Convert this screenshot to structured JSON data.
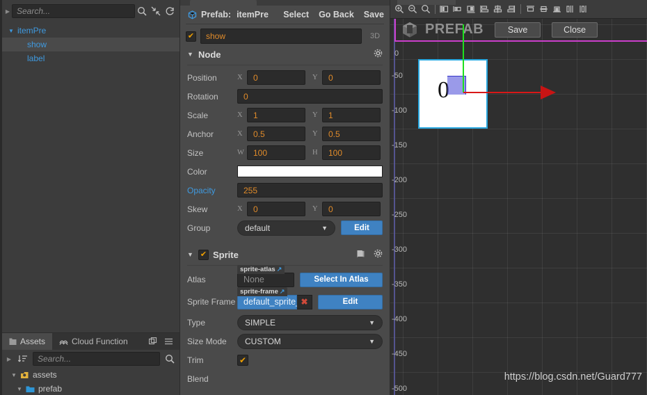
{
  "hierarchy": {
    "search_placeholder": "Search...",
    "icons": [
      "search-icon",
      "collapse-icon",
      "refresh-icon"
    ],
    "tree": [
      {
        "label": "itemPre",
        "depth": 0,
        "expanded": true,
        "selected": false
      },
      {
        "label": "show",
        "depth": 1,
        "expanded": false,
        "selected": true
      },
      {
        "label": "label",
        "depth": 1,
        "expanded": false,
        "selected": false
      }
    ]
  },
  "assets": {
    "tabs": [
      {
        "label": "Assets",
        "active": true,
        "icon": "assets-icon"
      },
      {
        "label": "Cloud Function",
        "active": false,
        "icon": "cloud-function-icon"
      }
    ],
    "search_placeholder": "Search...",
    "tree": [
      {
        "label": "assets",
        "depth": 0,
        "icon": "folder-root-icon"
      },
      {
        "label": "prefab",
        "depth": 1,
        "icon": "folder-icon"
      }
    ]
  },
  "inspector": {
    "prefab_bar": {
      "icon": "prefab-icon",
      "label": "Prefab:",
      "name": "itemPre",
      "actions": [
        "Select",
        "Go Back",
        "Save"
      ]
    },
    "node_name": "show",
    "node_enabled": true,
    "mode_3d": "3D",
    "node_section": {
      "title": "Node",
      "gear_icon": "gear-icon",
      "properties": [
        {
          "label": "Position",
          "type": "xy",
          "x": "0",
          "y": "0"
        },
        {
          "label": "Rotation",
          "type": "single",
          "value": "0"
        },
        {
          "label": "Scale",
          "type": "xy",
          "x": "1",
          "y": "1"
        },
        {
          "label": "Anchor",
          "type": "xy",
          "x": "0.5",
          "y": "0.5"
        },
        {
          "label": "Size",
          "type": "wh",
          "x": "100",
          "y": "100"
        },
        {
          "label": "Color",
          "type": "color",
          "value": "#ffffff"
        },
        {
          "label": "Opacity",
          "type": "single",
          "value": "255",
          "link": true
        },
        {
          "label": "Skew",
          "type": "xy",
          "x": "0",
          "y": "0"
        },
        {
          "label": "Group",
          "type": "select",
          "value": "default",
          "button": "Edit"
        }
      ]
    },
    "sprite_section": {
      "title": "Sprite",
      "enabled": true,
      "help_icon": "book-icon",
      "gear_icon": "gear-icon",
      "atlas": {
        "label": "Atlas",
        "tag": "sprite-atlas",
        "value": "None",
        "button": "Select In Atlas"
      },
      "sprite_frame": {
        "label": "Sprite Frame",
        "tag": "sprite-frame",
        "value": "default_sprite_...",
        "clear": "✖",
        "button": "Edit"
      },
      "type": {
        "label": "Type",
        "value": "SIMPLE"
      },
      "size_mode": {
        "label": "Size Mode",
        "value": "CUSTOM"
      },
      "trim": {
        "label": "Trim",
        "checked": true
      },
      "blend": {
        "label": "Blend"
      }
    }
  },
  "scene": {
    "toolbar_icons": [
      "zoom-in-icon",
      "zoom-out-icon",
      "zoom-reset-icon",
      "align-left-icon",
      "align-center-h-icon",
      "align-right-icon",
      "distribute-left-icon",
      "distribute-center-icon",
      "distribute-right-icon",
      "align-top-icon",
      "align-middle-icon",
      "align-bottom-icon",
      "distribute-h-icon",
      "distribute-v-icon"
    ],
    "prefab_banner": {
      "icon": "prefab-cube-icon",
      "title": "PREFAB",
      "save": "Save",
      "close": "Close"
    },
    "ruler": {
      "origin_label": "0",
      "ticks": [
        "-50",
        "-100",
        "-150",
        "-200",
        "-250",
        "-300",
        "-350",
        "-400",
        "-450",
        "-500"
      ]
    },
    "node_preview": {
      "zero_glyph": "0"
    },
    "watermark": "https://blog.csdn.net/Guard777",
    "colors": {
      "selection_border": "#29a8e0",
      "axis_x": "#d81818",
      "axis_y": "#1ee01e",
      "prefab_outline": "#cc3fcc"
    }
  }
}
